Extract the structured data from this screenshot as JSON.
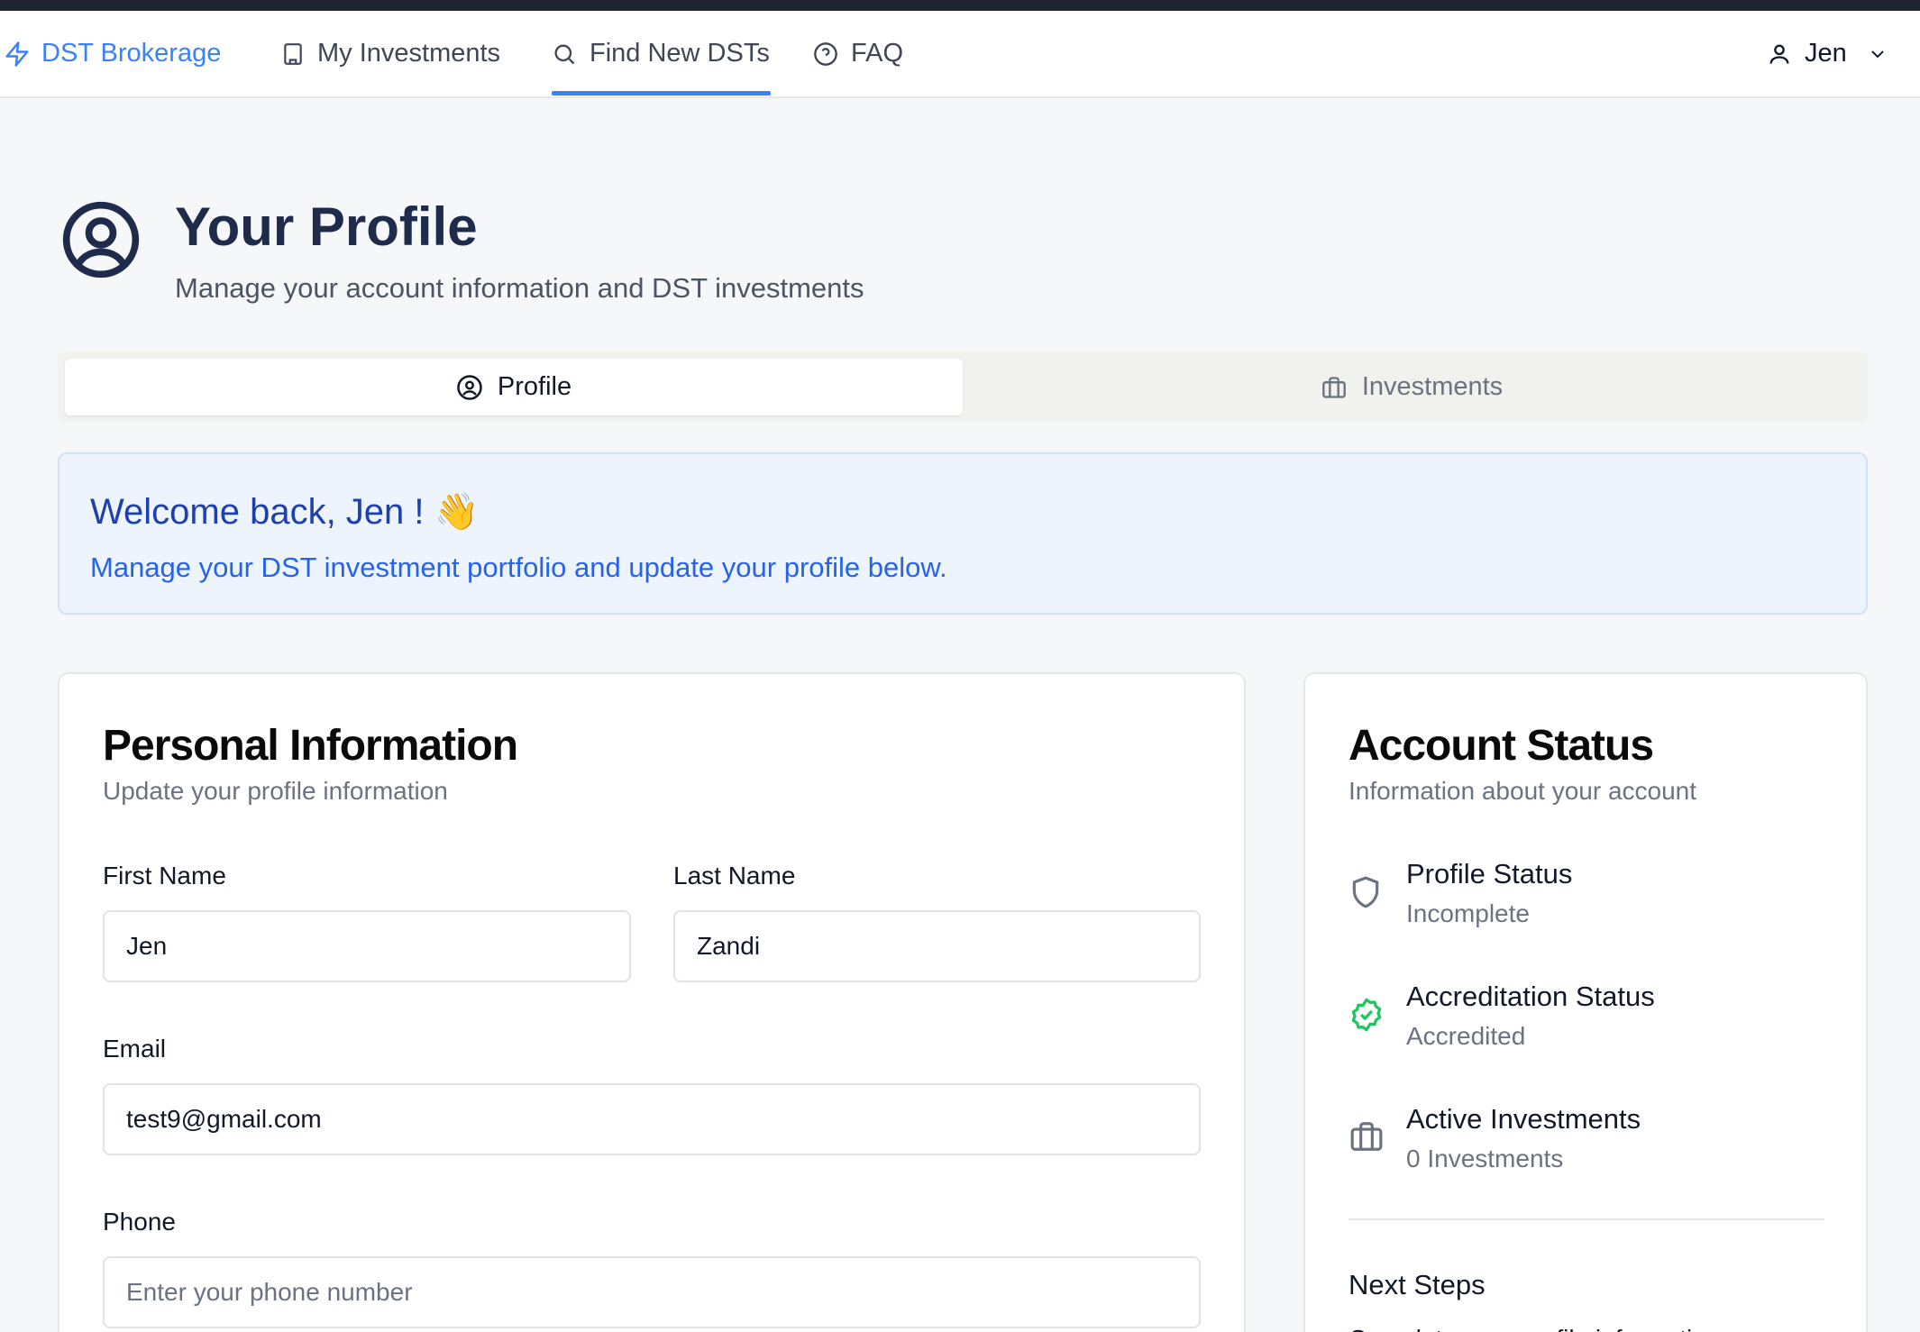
{
  "nav": {
    "brand": "DST Brokerage",
    "my_investments": "My Investments",
    "find_new": "Find New DSTs",
    "faq": "FAQ",
    "user": "Jen",
    "accent_color": "#3b82f6"
  },
  "header": {
    "title": "Your Profile",
    "subtitle": "Manage your account information and DST investments"
  },
  "tabs": [
    {
      "label": "Profile",
      "icon": "user-circle-icon",
      "active": true
    },
    {
      "label": "Investments",
      "icon": "briefcase-icon",
      "active": false
    }
  ],
  "welcome": {
    "title": "Welcome back, Jen ! 👋",
    "subtitle": "Manage your DST investment portfolio and update your profile below."
  },
  "personal": {
    "title": "Personal Information",
    "subtitle": "Update your profile information",
    "first_name": {
      "label": "First Name",
      "value": "Jen"
    },
    "last_name": {
      "label": "Last Name",
      "value": "Zandi"
    },
    "email": {
      "label": "Email",
      "value": "test9@gmail.com"
    },
    "phone": {
      "label": "Phone",
      "value": "",
      "placeholder": "Enter your phone number"
    }
  },
  "status": {
    "title": "Account Status",
    "subtitle": "Information about your account",
    "items": [
      {
        "label": "Profile Status",
        "value": "Incomplete",
        "icon": "shield-icon"
      },
      {
        "label": "Accreditation Status",
        "value": "Accredited",
        "icon": "badge-check-icon",
        "color": "#22c55e"
      },
      {
        "label": "Active Investments",
        "value": "0 Investments",
        "icon": "briefcase-icon"
      }
    ],
    "next_steps": "Next Steps",
    "step_1": "Complete your profile information"
  }
}
